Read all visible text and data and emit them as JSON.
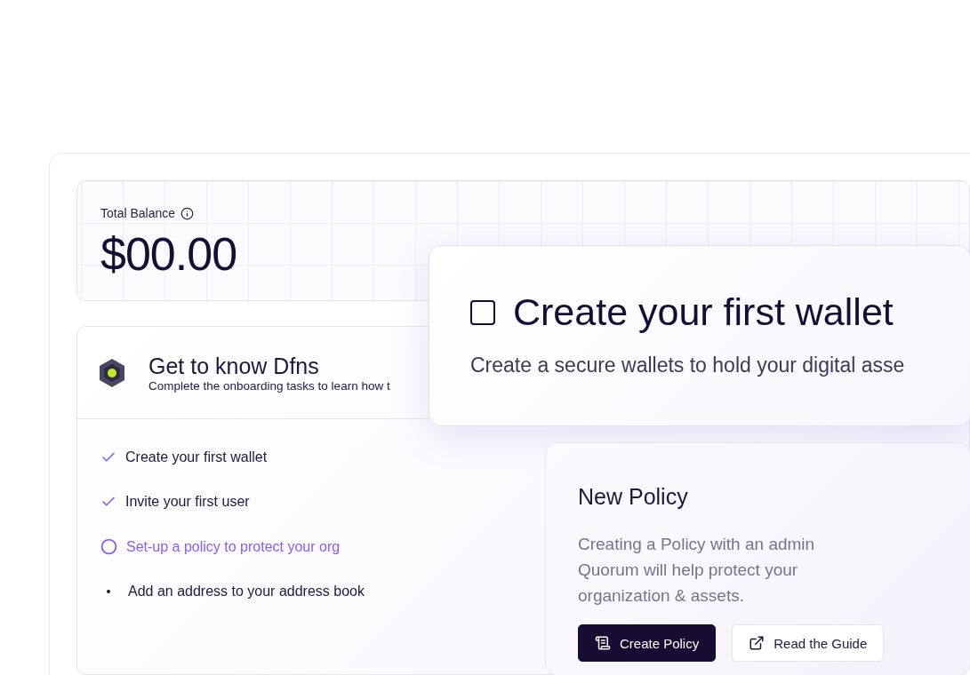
{
  "balance": {
    "label": "Total Balance",
    "amount": "$00.00"
  },
  "onboarding": {
    "title": "Get to know Dfns",
    "subtitle": "Complete the onboarding tasks to learn how t",
    "tasks": [
      {
        "label": "Create your first wallet",
        "kind": "done"
      },
      {
        "label": "Invite your first user",
        "kind": "done"
      },
      {
        "label": "Set-up a policy to protect your org",
        "kind": "current"
      },
      {
        "label": "Add an address to your address book",
        "kind": "pending"
      }
    ]
  },
  "task_card": {
    "title": "Create your first wallet",
    "checked": false,
    "description": "Create a secure wallets to hold your digital asse"
  },
  "policy_card": {
    "title": "New Policy",
    "description": "Creating a Policy with an admin Quorum will help protect your organization & assets.",
    "buttons": [
      {
        "label": "Create Policy",
        "kind": "primary"
      },
      {
        "label": "Read the Guide",
        "kind": "secondary"
      }
    ]
  }
}
